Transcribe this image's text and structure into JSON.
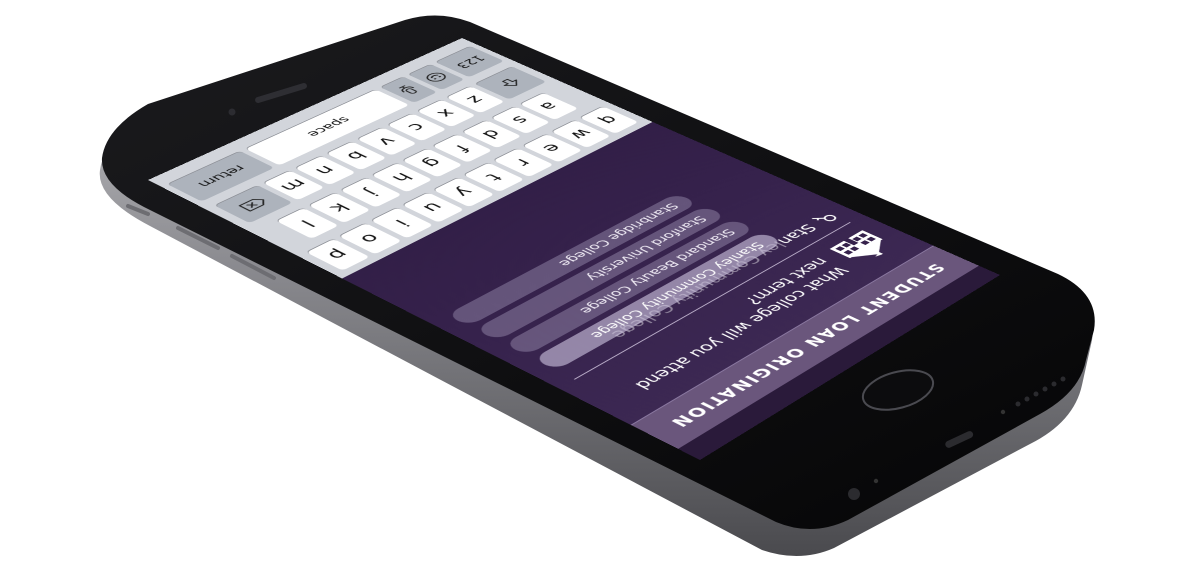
{
  "app": {
    "header_title": "Student Loan Origination"
  },
  "form": {
    "question": "What college will you attend next term?",
    "input_typed": "Stan",
    "input_suggestion_rest": "ley Community College",
    "suggestions": [
      "Stanley Community College",
      "Standard Beauty College",
      "Stanford University",
      "Stanbridge College"
    ],
    "icons": {
      "school": "school-building-icon",
      "input": "key-icon"
    }
  },
  "keyboard": {
    "row1": [
      "q",
      "w",
      "e",
      "r",
      "t",
      "y",
      "u",
      "i",
      "o",
      "p"
    ],
    "row2": [
      "a",
      "s",
      "d",
      "f",
      "g",
      "h",
      "j",
      "k",
      "l"
    ],
    "row3": [
      "z",
      "x",
      "c",
      "v",
      "b",
      "n",
      "m"
    ],
    "shift_icon": "shift-icon",
    "delete_icon": "backspace-icon",
    "numbers_label": "123",
    "emoji_icon": "emoji-icon",
    "mic_icon": "microphone-icon",
    "space_label": "space",
    "return_label": "return"
  },
  "colors": {
    "screen_bg": "#35214b",
    "header_bg": "#6a567c",
    "suggestion_bg": "#8c7ca6",
    "keyboard_bg": "#d2d5db",
    "phone_frame": "#0b0b0d",
    "phone_edge": "#8c8c90"
  }
}
